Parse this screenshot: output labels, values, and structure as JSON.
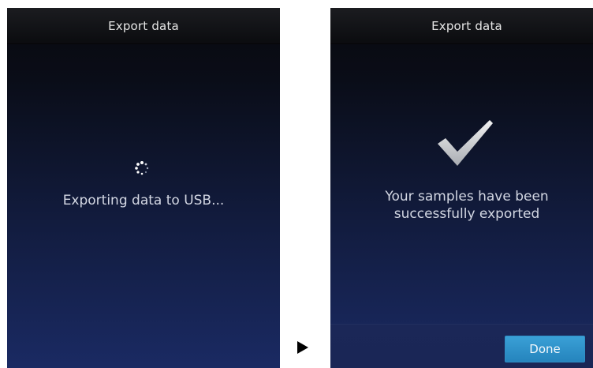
{
  "screens": [
    {
      "title": "Export data",
      "status": "Exporting data to USB...",
      "icon": "loading-spinner-icon"
    },
    {
      "title": "Export data",
      "status_lines": [
        "Your samples have been",
        "successfully exported"
      ],
      "icon": "checkmark-icon",
      "done_label": "Done"
    }
  ],
  "transition_icon": "arrow-right-icon",
  "colors": {
    "title_text": "#e6e6e6",
    "body_text": "#d3d7e3",
    "button": "#2f90c8",
    "background_bottom": "#1a2a63"
  }
}
